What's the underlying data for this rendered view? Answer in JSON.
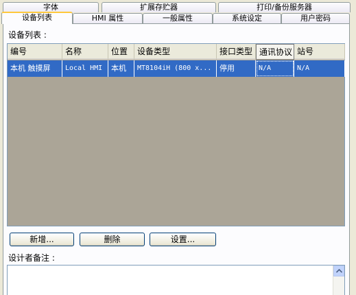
{
  "tabs_row1": [
    "字体",
    "扩展存贮器",
    "打印/备份服务器"
  ],
  "tabs_row2": [
    "设备列表",
    "HMI 属性",
    "一般属性",
    "系统设定",
    "用户密码"
  ],
  "device_list_label": "设备列表 :",
  "columns": [
    "编号",
    "名称",
    "位置",
    "设备类型",
    "接口类型",
    "通讯协议",
    "站号"
  ],
  "rows": [
    [
      "本机 触摸屏",
      "Local HMI",
      "本机",
      "MT8104iH (800 x...",
      "停用",
      "N/A",
      "N/A"
    ]
  ],
  "buttons": {
    "add": "新增...",
    "delete": "删除",
    "settings": "设置..."
  },
  "notes_label": "设计者备注 :",
  "colors": {
    "selection": "#316ac5",
    "grid_bg": "#aba597",
    "active_tab_accent": "#ffc83c"
  }
}
